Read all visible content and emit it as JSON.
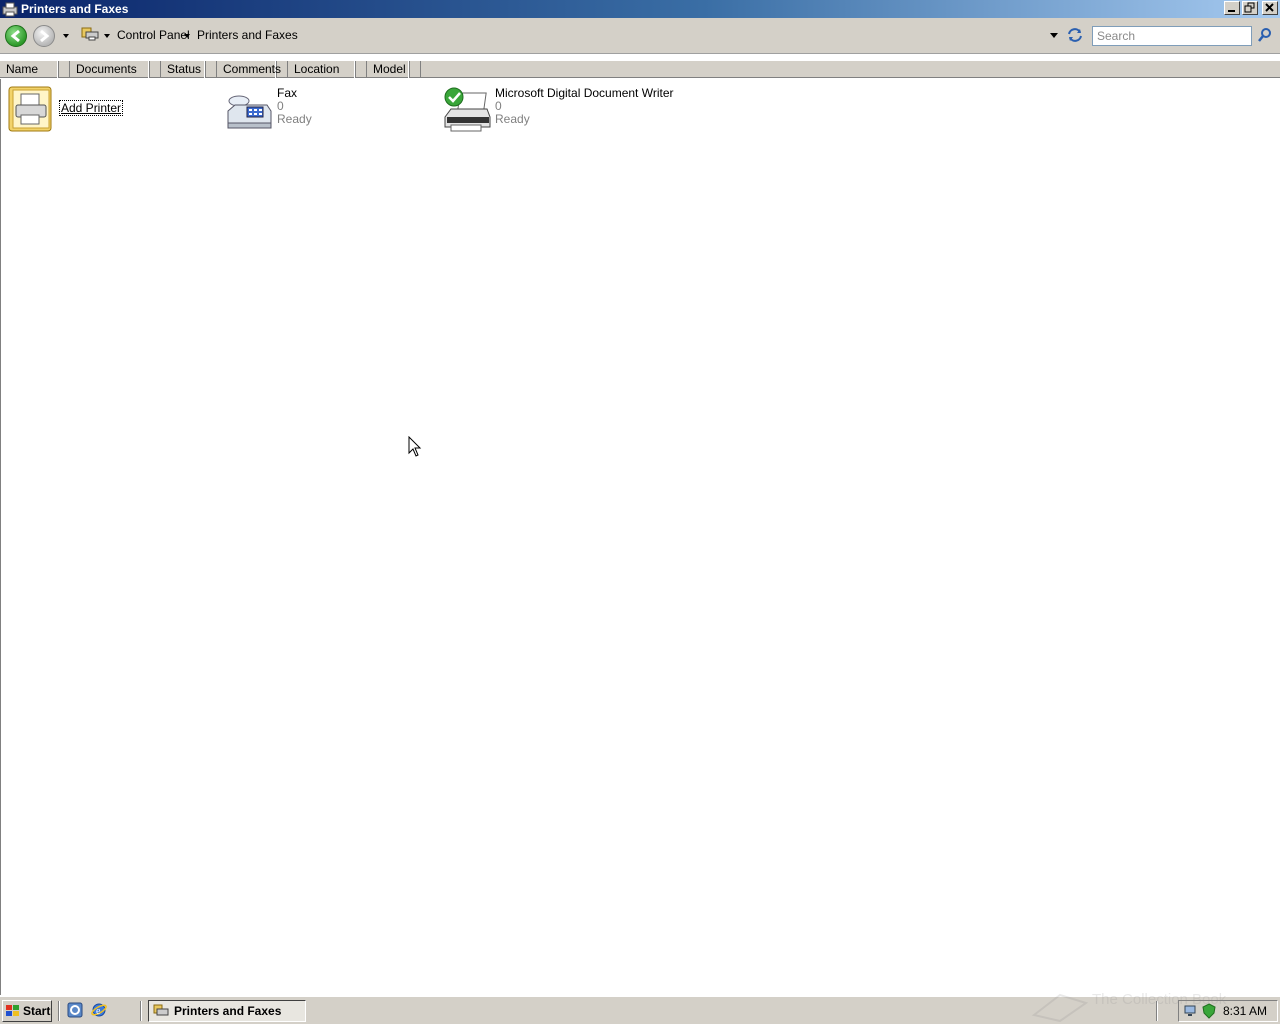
{
  "window": {
    "title": "Printers and Faxes"
  },
  "navbar": {
    "breadcrumb": [
      "Control Panel",
      "Printers and Faxes"
    ],
    "search_placeholder": "Search"
  },
  "columns": [
    "Name",
    "Documents",
    "Status",
    "Comments",
    "Location",
    "Model"
  ],
  "items": [
    {
      "name": "Add Printer",
      "icon": "add-printer-icon"
    },
    {
      "name": "Fax",
      "documents": "0",
      "status": "Ready",
      "icon": "fax-icon"
    },
    {
      "name": "Microsoft Digital Document Writer",
      "documents": "0",
      "status": "Ready",
      "icon": "printer-icon",
      "default": true
    }
  ],
  "taskbar": {
    "start_label": "Start",
    "task_label": "Printers and Faxes",
    "clock": "8:31 AM"
  },
  "watermark": "The Collection Book",
  "colors": {
    "titlebar_start": "#0a246a",
    "titlebar_end": "#a6caf0",
    "chrome": "#d4d0c8",
    "subtext": "#808080"
  }
}
